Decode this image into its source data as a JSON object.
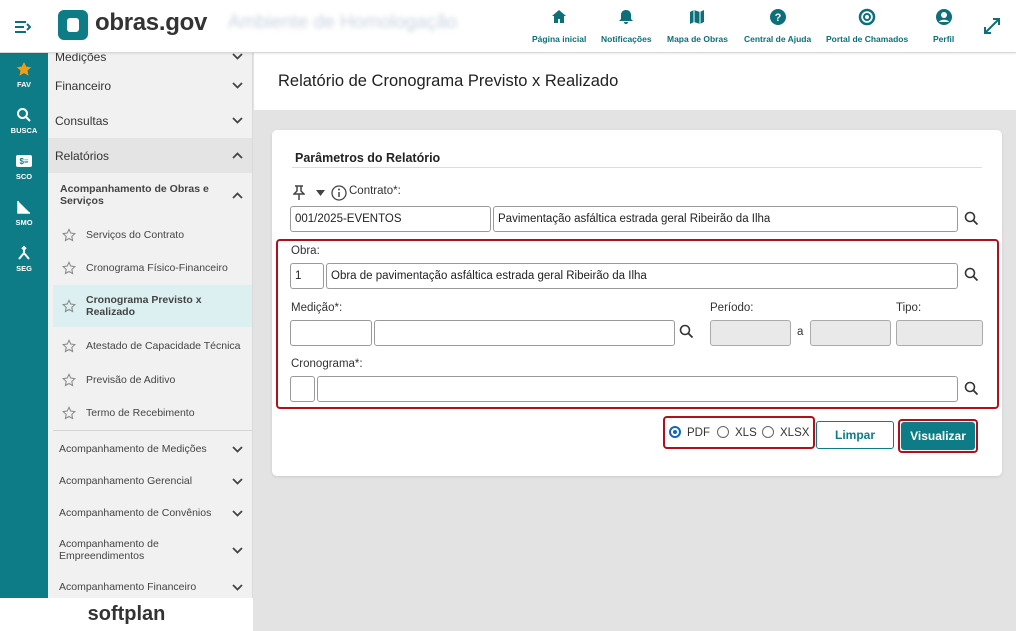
{
  "header": {
    "logo_text": "obras.gov",
    "environment": "Ambiente de Homologação",
    "nav": [
      {
        "label": "Página inicial",
        "icon": "home-icon"
      },
      {
        "label": "Notificações",
        "icon": "bell-icon"
      },
      {
        "label": "Mapa de Obras",
        "icon": "map-icon"
      },
      {
        "label": "Central de Ajuda",
        "icon": "help-icon"
      },
      {
        "label": "Portal de Chamados",
        "icon": "support-icon"
      },
      {
        "label": "Perfil",
        "icon": "user-icon"
      }
    ]
  },
  "rail": [
    {
      "label": "FAV",
      "icon": "star-icon"
    },
    {
      "label": "BUSCA",
      "icon": "search-icon"
    },
    {
      "label": "SCO",
      "icon": "sco-icon"
    },
    {
      "label": "SMO",
      "icon": "smo-icon"
    },
    {
      "label": "SEG",
      "icon": "seg-icon"
    }
  ],
  "sidebar": {
    "partial_top": "Medições",
    "sections": [
      {
        "label": "Financeiro"
      },
      {
        "label": "Consultas"
      },
      {
        "label": "Relatórios"
      }
    ],
    "subgroup": "Acompanhamento de Obras e Serviços",
    "items": [
      {
        "label": "Serviços do Contrato"
      },
      {
        "label": "Cronograma Físico-Financeiro"
      },
      {
        "label": "Cronograma Previsto x Realizado"
      },
      {
        "label": "Atestado de Capacidade Técnica"
      },
      {
        "label": "Previsão de Aditivo"
      },
      {
        "label": "Termo de Recebimento"
      }
    ],
    "groups": [
      {
        "label": "Acompanhamento de Medições"
      },
      {
        "label": "Acompanhamento Gerencial"
      },
      {
        "label": "Acompanhamento de Convênios"
      },
      {
        "label": "Acompanhamento de Empreendimentos"
      },
      {
        "label": "Acompanhamento Financeiro"
      }
    ],
    "footer_brand": "softplan"
  },
  "page": {
    "title": "Relatório de Cronograma Previsto x Realizado"
  },
  "form": {
    "section_title": "Parâmetros do Relatório",
    "contrato_label": "Contrato*:",
    "contrato_code": "001/2025-EVENTOS",
    "contrato_desc": "Pavimentação asfáltica estrada geral Ribeirão da Ilha",
    "obra_label": "Obra:",
    "obra_code": "1",
    "obra_desc": "Obra de pavimentação asfáltica estrada geral Ribeirão da Ilha",
    "medicao_label": "Medição*:",
    "medicao_code": "",
    "medicao_desc": "",
    "periodo_label": "Período:",
    "periodo_sep": "a",
    "periodo_de": "",
    "periodo_ate": "",
    "tipo_label": "Tipo:",
    "tipo_value": "",
    "cronograma_label": "Cronograma*:",
    "cronograma_code": "",
    "cronograma_desc": "",
    "formats": [
      "PDF",
      "XLS",
      "XLSX"
    ],
    "selected_format": "PDF",
    "btn_limpar": "Limpar",
    "btn_visualizar": "Visualizar"
  },
  "colors": {
    "brand": "#0d7c86",
    "highlight": "#b0101c",
    "accent_star": "#f39c12"
  }
}
